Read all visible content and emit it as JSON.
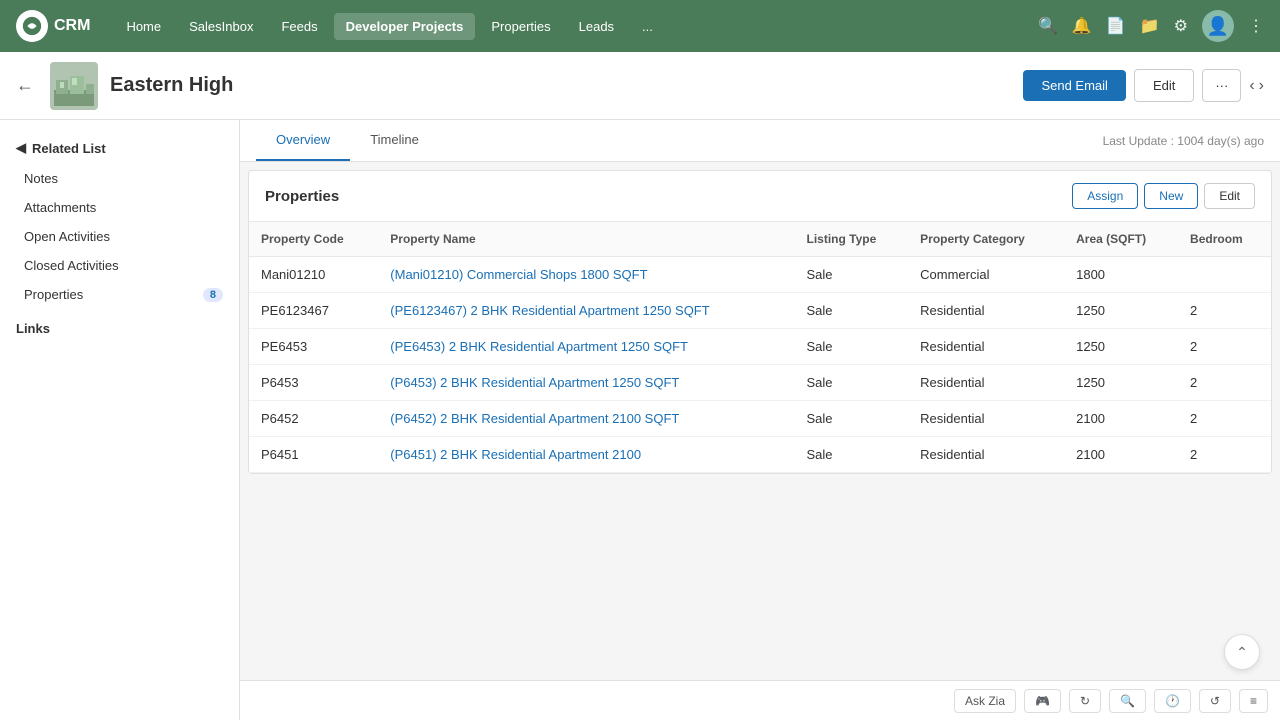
{
  "app": {
    "name": "CRM"
  },
  "nav": {
    "items": [
      {
        "label": "Home",
        "active": false
      },
      {
        "label": "SalesInbox",
        "active": false
      },
      {
        "label": "Feeds",
        "active": false
      },
      {
        "label": "Developer Projects",
        "active": true
      },
      {
        "label": "Properties",
        "active": false
      },
      {
        "label": "Leads",
        "active": false
      },
      {
        "label": "...",
        "active": false
      }
    ]
  },
  "header": {
    "title": "Eastern High",
    "send_email_label": "Send Email",
    "edit_label": "Edit",
    "more_label": "···",
    "last_update": "Last Update : 1004 day(s) ago"
  },
  "tabs": [
    {
      "label": "Overview",
      "active": true
    },
    {
      "label": "Timeline",
      "active": false
    }
  ],
  "sidebar": {
    "related_list_label": "Related List",
    "items": [
      {
        "label": "Notes",
        "badge": null
      },
      {
        "label": "Attachments",
        "badge": null
      },
      {
        "label": "Open Activities",
        "badge": null
      },
      {
        "label": "Closed Activities",
        "badge": null
      },
      {
        "label": "Properties",
        "badge": "8"
      }
    ],
    "links_label": "Links"
  },
  "properties_section": {
    "title": "Properties",
    "assign_label": "Assign",
    "new_label": "New",
    "edit_label": "Edit",
    "columns": [
      "Property Code",
      "Property Name",
      "Listing Type",
      "Property Category",
      "Area (SQFT)",
      "Bedroom"
    ],
    "rows": [
      {
        "code": "Mani01210",
        "name": "(Mani01210) Commercial Shops 1800 SQFT",
        "listing_type": "Sale",
        "category": "Commercial",
        "area": "1800",
        "bedroom": ""
      },
      {
        "code": "PE6123467",
        "name": "(PE6123467) 2 BHK Residential Apartment 1250 SQFT",
        "listing_type": "Sale",
        "category": "Residential",
        "area": "1250",
        "bedroom": "2"
      },
      {
        "code": "PE6453",
        "name": "(PE6453) 2 BHK Residential Apartment 1250 SQFT",
        "listing_type": "Sale",
        "category": "Residential",
        "area": "1250",
        "bedroom": "2"
      },
      {
        "code": "P6453",
        "name": "(P6453) 2 BHK Residential Apartment 1250 SQFT",
        "listing_type": "Sale",
        "category": "Residential",
        "area": "1250",
        "bedroom": "2"
      },
      {
        "code": "P6452",
        "name": "(P6452) 2 BHK Residential Apartment 2100 SQFT",
        "listing_type": "Sale",
        "category": "Residential",
        "area": "2100",
        "bedroom": "2"
      },
      {
        "code": "P6451",
        "name": "(P6451) 2 BHK Residential Apartment 2100",
        "listing_type": "Sale",
        "category": "Residential",
        "area": "2100",
        "bedroom": "2"
      }
    ]
  },
  "bottom_toolbar": {
    "ask_zia_label": "Ask Zia"
  },
  "colors": {
    "nav_bg": "#4a7c59",
    "link_color": "#1a6fb5",
    "btn_primary": "#1a6fb5"
  }
}
